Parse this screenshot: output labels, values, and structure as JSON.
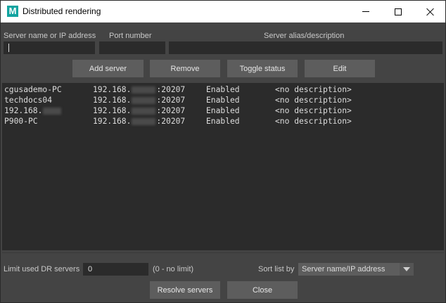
{
  "window": {
    "icon_letter": "M",
    "title": "Distributed rendering"
  },
  "form": {
    "server_label": "Server name or IP address",
    "port_label": "Port number",
    "alias_label": "Server alias/description",
    "server_value": "",
    "port_value": "",
    "alias_value": ""
  },
  "buttons": {
    "add": "Add server",
    "remove": "Remove",
    "toggle": "Toggle status",
    "edit": "Edit",
    "resolve": "Resolve servers",
    "close": "Close"
  },
  "servers": [
    {
      "name": "cgusademo-PC",
      "name_masked": false,
      "ip_prefix": "192.168.",
      "port": ":20207",
      "status": "Enabled",
      "description": "<no description>"
    },
    {
      "name": "techdocs04",
      "name_masked": false,
      "ip_prefix": "192.168.",
      "port": ":20207",
      "status": "Enabled",
      "description": "<no description>"
    },
    {
      "name": "192.168.",
      "name_masked": true,
      "ip_prefix": "192.168.",
      "port": ":20207",
      "status": "Enabled",
      "description": "<no description>"
    },
    {
      "name": "P900-PC",
      "name_masked": false,
      "ip_prefix": "192.168.",
      "port": ":20207",
      "status": "Enabled",
      "description": "<no description>"
    }
  ],
  "footer": {
    "limit_label": "Limit used DR servers",
    "limit_value": "0",
    "limit_hint": "(0 - no limit)",
    "sort_label": "Sort list by",
    "sort_value": "Server name/IP address"
  },
  "colors": {
    "background": "#444444",
    "field": "#2b2b2b",
    "button": "#5d5d5d",
    "icon": "#12a4a0"
  }
}
